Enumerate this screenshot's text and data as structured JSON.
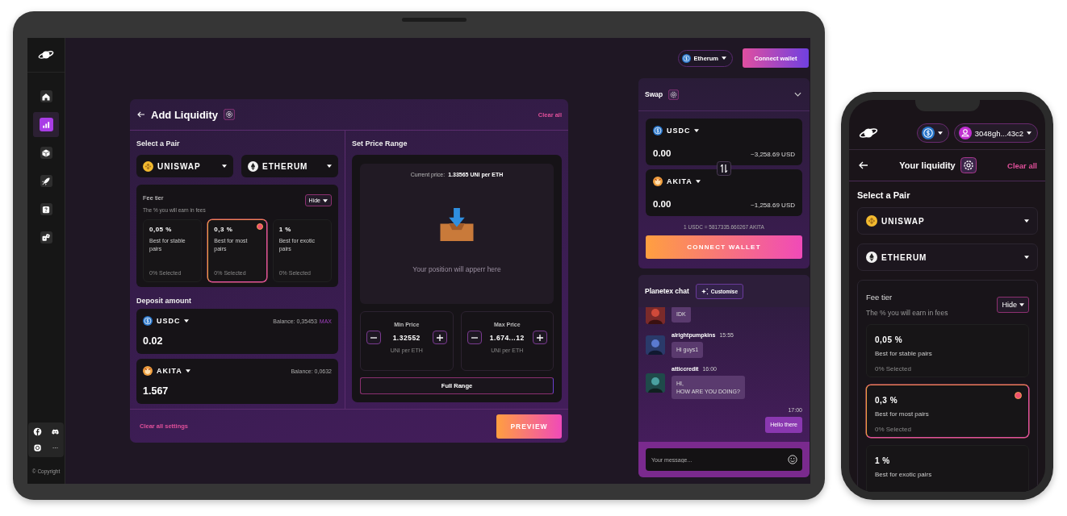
{
  "tablet": {
    "sidebar": {
      "items": [
        {
          "selected": false
        },
        {
          "selected": true
        },
        {
          "selected": false
        },
        {
          "selected": false
        },
        {
          "selected": false
        },
        {
          "selected": false
        }
      ],
      "copyright": "© Copyright"
    },
    "topbar": {
      "network": "Etherum",
      "connect": "Connect wallet"
    },
    "liquidity": {
      "title": "Add Liquidity",
      "clear": "Clear all",
      "pair_heading": "Select a Pair",
      "tokens": [
        {
          "label": "UNISWAP",
          "kind": "bnb"
        },
        {
          "label": "ETHERUM",
          "kind": "eth"
        }
      ],
      "fee": {
        "title": "Fee tier",
        "subtitle": "The % you will earn in fees",
        "toggle": "Hide",
        "tiers": [
          {
            "rate": "0,05 %",
            "description": "Best for stable pairs",
            "share": "0% Selected",
            "selected": false
          },
          {
            "rate": "0,3 %",
            "description": "Best for most pairs",
            "share": "0% Selected",
            "selected": true
          },
          {
            "rate": "1 %",
            "description": "Best for exotic pairs",
            "share": "0% Selected",
            "selected": false
          }
        ]
      },
      "deposit": {
        "heading": "Deposit amount",
        "entries": [
          {
            "token": "USDC",
            "kind": "usdc",
            "balance": "Balance: 0,35453",
            "max": "MAX",
            "amount": "0.02"
          },
          {
            "token": "AKITA",
            "kind": "akita",
            "balance": "Balance: 0,0632",
            "amount": "1.567"
          }
        ]
      },
      "range": {
        "heading": "Set Price Range",
        "current_label": "Current price:",
        "current_value": "1.33565 UNI per ETH",
        "empty": "Your position will apperr here",
        "bounds": [
          {
            "label": "Min Price",
            "value": "1.32552",
            "unit": "UNI per ETH"
          },
          {
            "label": "Max Price",
            "value": "1.674...12",
            "unit": "UNI per ETH"
          }
        ],
        "full": "Full Range"
      },
      "reset": "Clear all settings",
      "preview": "PREVIEW"
    },
    "swap": {
      "title": "Swap",
      "rows": [
        {
          "token": "USDC",
          "kind": "usdc",
          "amount": "0.00",
          "usd": "~3,258.69 USD"
        },
        {
          "token": "AKITA",
          "kind": "akita",
          "amount": "0.00",
          "usd": "~1,258.69 USD"
        }
      ],
      "rate": "1 USDC = 5817335.660267 AKITA",
      "button": "CONNECT WALLET"
    },
    "chat": {
      "title": "Planetex chat",
      "customise": "Customise",
      "messages": [
        {
          "kind": "incoming",
          "text": "IDK"
        },
        {
          "kind": "incoming",
          "user": "alrightpumpkins",
          "time": "15:55",
          "text": "Hi guys1"
        },
        {
          "kind": "incoming",
          "user": "atticcredit",
          "time": "16:00",
          "text": "HI,\nHOW ARE YOU DOING?"
        },
        {
          "kind": "outgoing",
          "time": "17:00",
          "text": "Hello there"
        }
      ],
      "placeholder": "Your message..."
    }
  },
  "phone": {
    "account": "3048gh...43c2",
    "title": "Your liquidity",
    "clear": "Clear all",
    "pair_heading": "Select a Pair",
    "tokens": [
      {
        "label": "UNISWAP",
        "kind": "bnb"
      },
      {
        "label": "ETHERUM",
        "kind": "eth"
      }
    ],
    "fee": {
      "title": "Fee tier",
      "subtitle": "The % you will earn in fees",
      "toggle": "Hide",
      "tiers": [
        {
          "rate": "0,05 %",
          "description": "Best for stable pairs",
          "share": "0% Selected",
          "selected": false
        },
        {
          "rate": "0,3 %",
          "description": "Best for most pairs",
          "share": "0% Selected",
          "selected": true
        },
        {
          "rate": "1 %",
          "description": "Best for exotic pairs",
          "selected": false
        }
      ]
    }
  }
}
